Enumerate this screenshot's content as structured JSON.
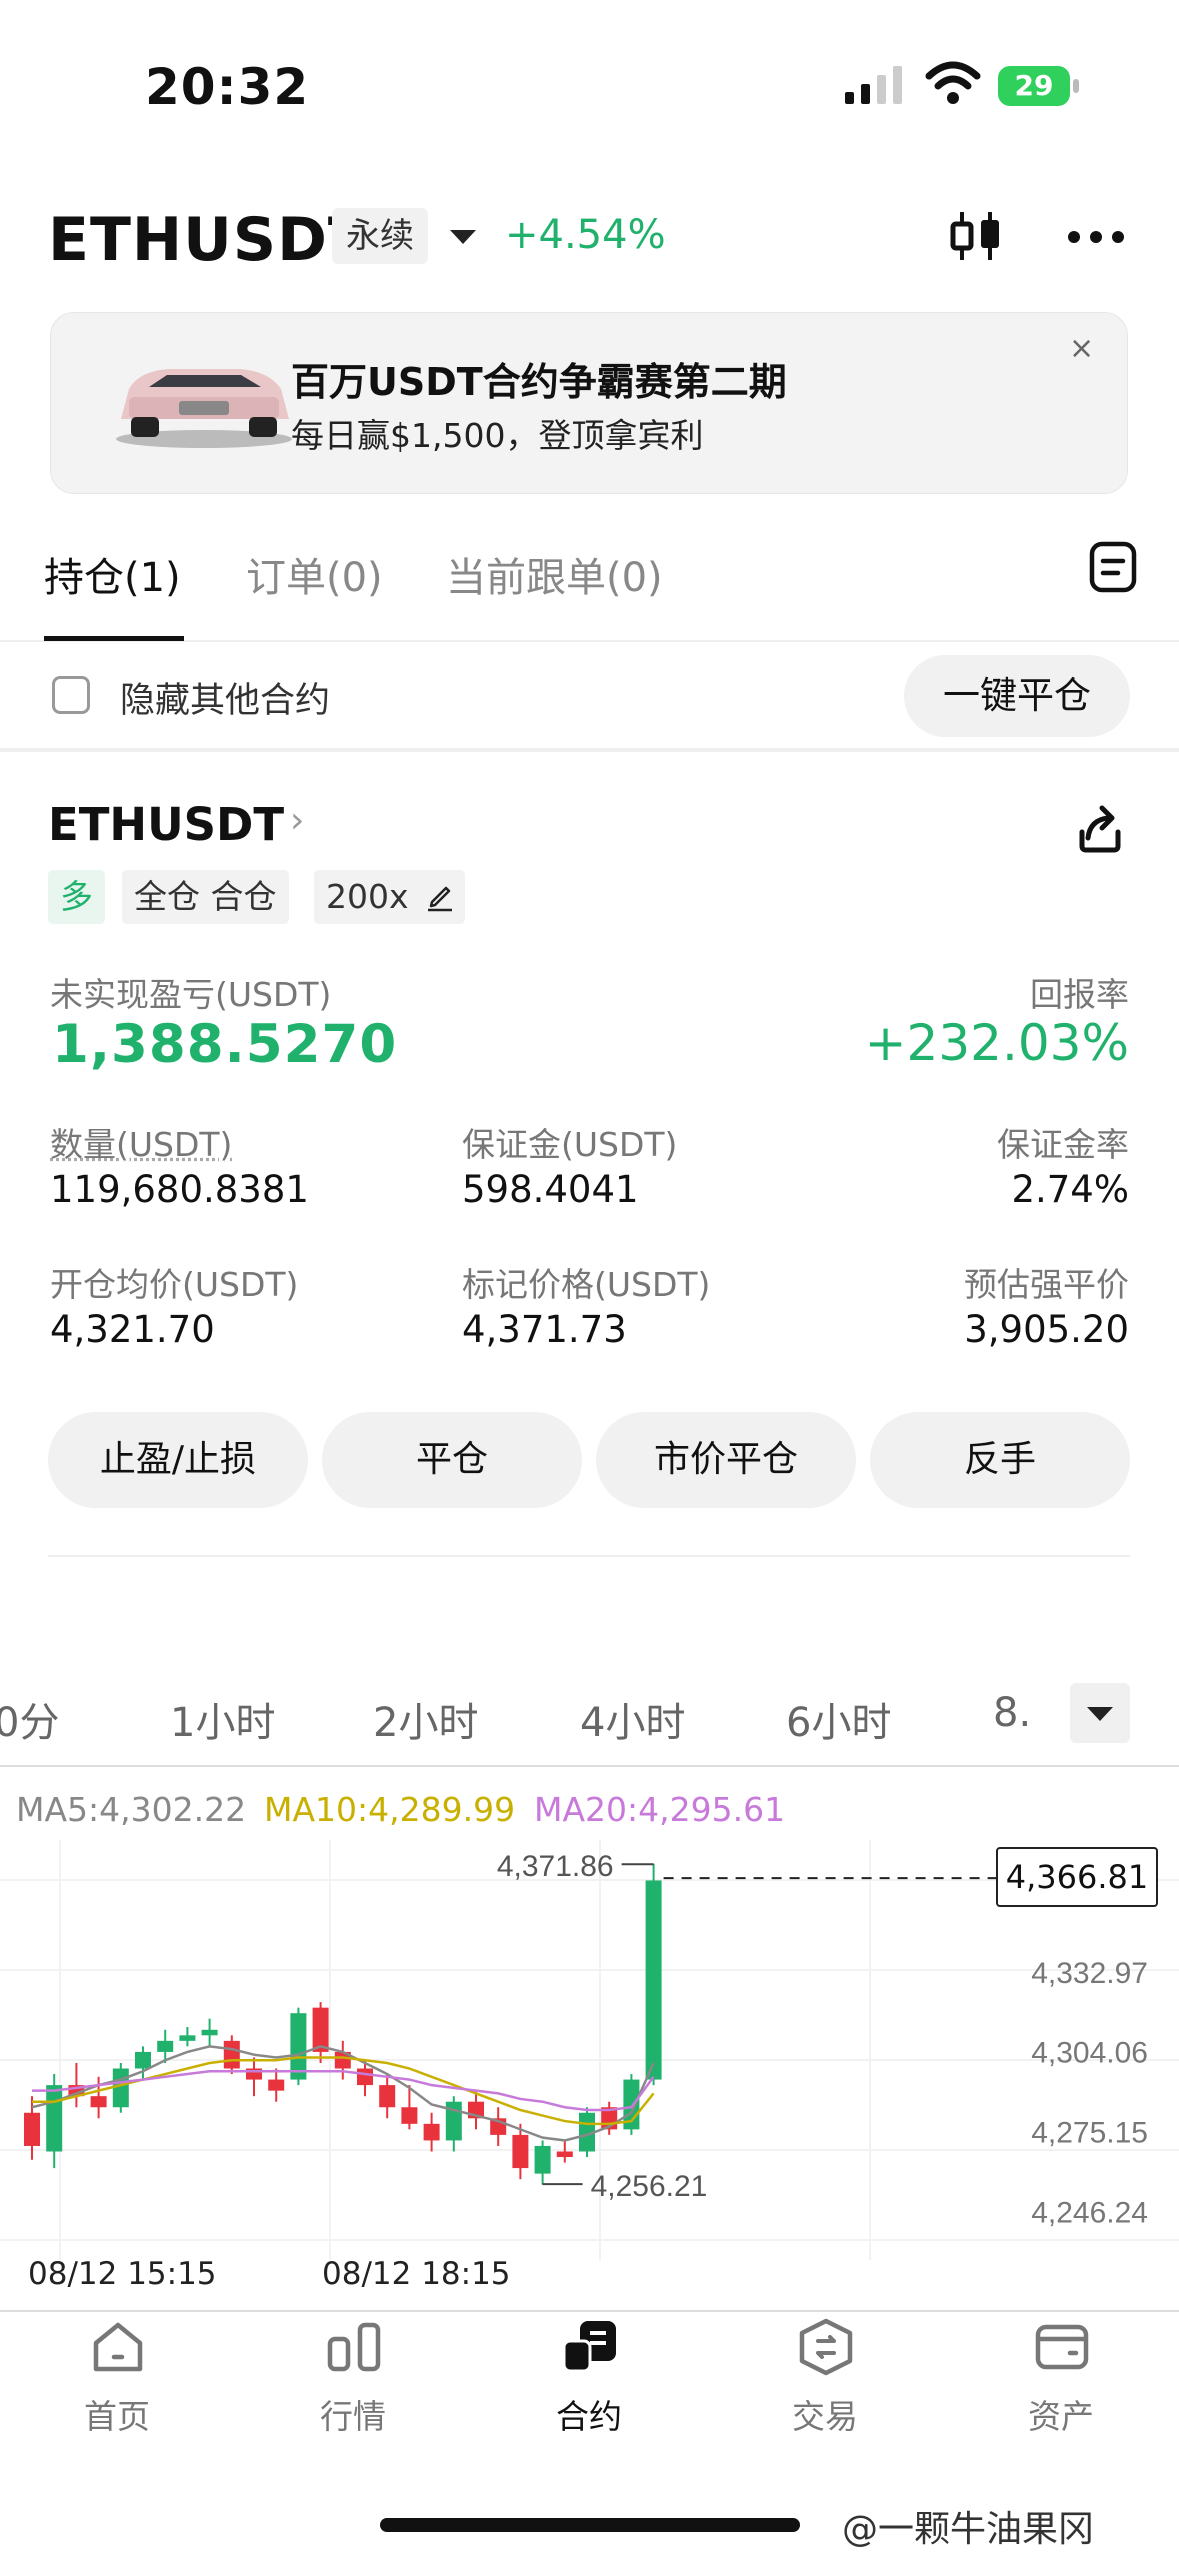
{
  "status_bar": {
    "time": "20:32",
    "battery": "29"
  },
  "header": {
    "symbol": "ETHUSDT",
    "contract_type": "永续",
    "change": "+4.54%"
  },
  "banner": {
    "title": "百万USDT合约争霸赛第二期",
    "subtitle": "每日赢$1,500，登顶拿宾利",
    "close": "×"
  },
  "tabs": [
    {
      "label": "持仓(1)"
    },
    {
      "label": "订单(0)"
    },
    {
      "label": "当前跟单(0)"
    }
  ],
  "filter": {
    "hide_label": "隐藏其他合约",
    "close_all": "一键平仓"
  },
  "position": {
    "symbol": "ETHUSDT",
    "arrow": "›",
    "side": "多",
    "mode": "全仓 合仓",
    "leverage": "200x",
    "pnl_label": "未实现盈亏(USDT)",
    "pnl": "1,388.5270",
    "roi_label": "回报率",
    "roi": "+232.03%",
    "qty_label": "数量(USDT)",
    "qty": "119,680.8381",
    "margin_label": "保证金(USDT)",
    "margin": "598.4041",
    "margin_rate_label": "保证金率",
    "margin_rate": "2.74%",
    "entry_label": "开仓均价(USDT)",
    "entry": "4,321.70",
    "mark_label": "标记价格(USDT)",
    "mark": "4,371.73",
    "liq_label": "预估强平价",
    "liq": "3,905.20"
  },
  "actions": [
    "止盈/止损",
    "平仓",
    "市价平仓",
    "反手"
  ],
  "timeframes": [
    "0分",
    "1小时",
    "2小时",
    "4小时",
    "6小时",
    "8."
  ],
  "ma": {
    "ma5": "MA5:4,302.22",
    "ma10": "MA10:4,289.99",
    "ma20": "MA20:4,295.61"
  },
  "colors": {
    "up": "#20b26c",
    "down": "#e8323c",
    "ma5": "#888888",
    "ma10": "#c9b000",
    "ma20": "#c77ad9"
  },
  "chart_data": {
    "type": "candlestick",
    "high_label": "4,371.86",
    "low_label": "4,256.21",
    "last_price": "4,366.81",
    "y_ticks": [
      "4,332.97",
      "4,304.06",
      "4,275.15",
      "4,246.24"
    ],
    "x_ticks": [
      "08/12 15:15",
      "08/12 18:15"
    ],
    "ylim": [
      4236,
      4377
    ],
    "candles": [
      {
        "o": 4282,
        "h": 4288,
        "l": 4265,
        "c": 4270
      },
      {
        "o": 4268,
        "h": 4296,
        "l": 4262,
        "c": 4292
      },
      {
        "o": 4292,
        "h": 4300,
        "l": 4284,
        "c": 4288
      },
      {
        "o": 4288,
        "h": 4295,
        "l": 4280,
        "c": 4284
      },
      {
        "o": 4284,
        "h": 4300,
        "l": 4282,
        "c": 4298
      },
      {
        "o": 4298,
        "h": 4306,
        "l": 4294,
        "c": 4304
      },
      {
        "o": 4304,
        "h": 4312,
        "l": 4300,
        "c": 4308
      },
      {
        "o": 4308,
        "h": 4313,
        "l": 4306,
        "c": 4310
      },
      {
        "o": 4310,
        "h": 4316,
        "l": 4306,
        "c": 4312
      },
      {
        "o": 4308,
        "h": 4310,
        "l": 4296,
        "c": 4298
      },
      {
        "o": 4298,
        "h": 4302,
        "l": 4288,
        "c": 4294
      },
      {
        "o": 4294,
        "h": 4298,
        "l": 4286,
        "c": 4290
      },
      {
        "o": 4294,
        "h": 4320,
        "l": 4292,
        "c": 4318
      },
      {
        "o": 4320,
        "h": 4322,
        "l": 4300,
        "c": 4304
      },
      {
        "o": 4304,
        "h": 4308,
        "l": 4294,
        "c": 4298
      },
      {
        "o": 4298,
        "h": 4301,
        "l": 4288,
        "c": 4292
      },
      {
        "o": 4292,
        "h": 4296,
        "l": 4280,
        "c": 4284
      },
      {
        "o": 4284,
        "h": 4292,
        "l": 4276,
        "c": 4278
      },
      {
        "o": 4278,
        "h": 4282,
        "l": 4268,
        "c": 4272
      },
      {
        "o": 4272,
        "h": 4288,
        "l": 4268,
        "c": 4286
      },
      {
        "o": 4286,
        "h": 4290,
        "l": 4276,
        "c": 4280
      },
      {
        "o": 4280,
        "h": 4284,
        "l": 4270,
        "c": 4274
      },
      {
        "o": 4274,
        "h": 4278,
        "l": 4258,
        "c": 4262
      },
      {
        "o": 4260,
        "h": 4272,
        "l": 4256,
        "c": 4270
      },
      {
        "o": 4268,
        "h": 4272,
        "l": 4264,
        "c": 4266
      },
      {
        "o": 4268,
        "h": 4284,
        "l": 4266,
        "c": 4282
      },
      {
        "o": 4284,
        "h": 4286,
        "l": 4274,
        "c": 4276
      },
      {
        "o": 4276,
        "h": 4296,
        "l": 4274,
        "c": 4294
      },
      {
        "o": 4294,
        "h": 4372,
        "l": 4292,
        "c": 4366
      }
    ],
    "ma5": [
      4284,
      4286,
      4289,
      4292,
      4294,
      4297,
      4301,
      4304,
      4306,
      4305,
      4303,
      4302,
      4303,
      4306,
      4304,
      4300,
      4296,
      4291,
      4285,
      4283,
      4281,
      4279,
      4276,
      4273,
      4272,
      4274,
      4277,
      4282,
      4300
    ],
    "ma10": [
      4286,
      4286,
      4288,
      4290,
      4292,
      4294,
      4296,
      4298,
      4300,
      4301,
      4301,
      4301,
      4302,
      4302,
      4302,
      4301,
      4300,
      4298,
      4295,
      4292,
      4289,
      4286,
      4283,
      4281,
      4279,
      4278,
      4278,
      4279,
      4289
    ],
    "ma20": [
      4290,
      4290,
      4291,
      4292,
      4293,
      4294,
      4295,
      4296,
      4297,
      4297,
      4297,
      4297,
      4297,
      4297,
      4297,
      4296,
      4295,
      4294,
      4292,
      4291,
      4290,
      4289,
      4287,
      4286,
      4284,
      4283,
      4283,
      4284,
      4295
    ]
  },
  "nav": [
    {
      "label": "首页",
      "icon": "home-icon"
    },
    {
      "label": "行情",
      "icon": "market-icon"
    },
    {
      "label": "合约",
      "icon": "futures-icon"
    },
    {
      "label": "交易",
      "icon": "trade-icon"
    },
    {
      "label": "资产",
      "icon": "wallet-icon"
    }
  ],
  "watermark": "@一颗牛油果冈"
}
